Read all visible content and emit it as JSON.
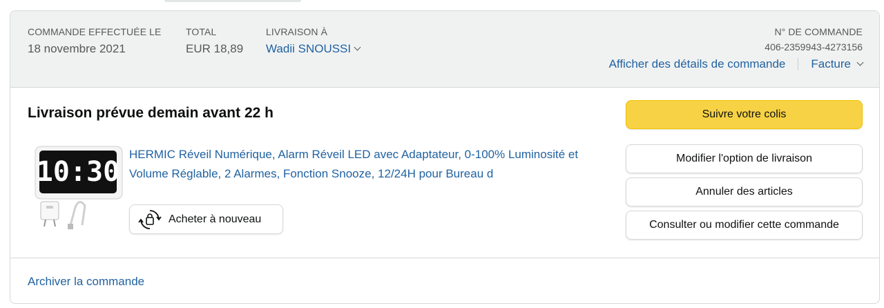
{
  "header": {
    "order_date_label": "COMMANDE EFFECTUÉE LE",
    "order_date": "18 novembre 2021",
    "total_label": "TOTAL",
    "total": "EUR 18,89",
    "ship_to_label": "LIVRAISON À",
    "ship_to": "Wadii SNOUSSI",
    "order_number_label": "N° DE COMMANDE",
    "order_number": "406-2359943-4273156",
    "details_link": "Afficher des détails de commande",
    "invoice_link": "Facture"
  },
  "shipment": {
    "status": "Livraison prévue demain avant 22 h",
    "product_title": "HERMIC Réveil Numérique, Alarm Réveil LED avec Adaptateur, 0-100% Luminosité et Volume Réglable, 2 Alarmes, Fonction Snooze, 12/24H pour Bureau d",
    "buy_again_label": "Acheter à nouveau",
    "clock_display": "10:30"
  },
  "actions": {
    "track": "Suivre votre colis",
    "change_delivery": "Modifier l'option de livraison",
    "cancel_items": "Annuler des articles",
    "view_edit_order": "Consulter ou modifier cette commande"
  },
  "footer": {
    "archive_link": "Archiver la commande"
  },
  "colors": {
    "link": "#2162a1",
    "primary_button": "#f7d244",
    "header_bg": "#f0f2f2"
  }
}
